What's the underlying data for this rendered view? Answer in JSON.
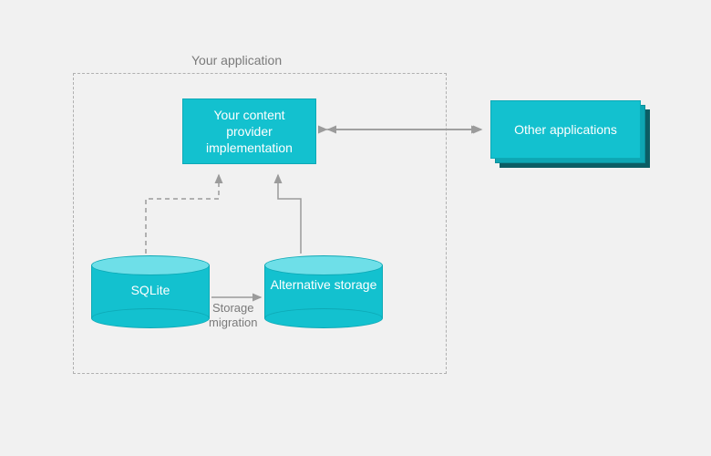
{
  "container_label": "Your application",
  "content_provider_label": "Your content provider implementation",
  "other_apps_label": "Other applications",
  "sqlite_label": "SQLite",
  "alt_storage_label": "Alternative storage",
  "migration_label": "Storage\nmigration",
  "colors": {
    "teal": "#13c1cf",
    "teal_light": "#6edfe8",
    "teal_border": "#0da9b6",
    "teal_dark": "#0b5d64",
    "bg": "#f1f1f1",
    "arrow": "#9b9b9b",
    "text_muted": "#7a7a7a"
  }
}
